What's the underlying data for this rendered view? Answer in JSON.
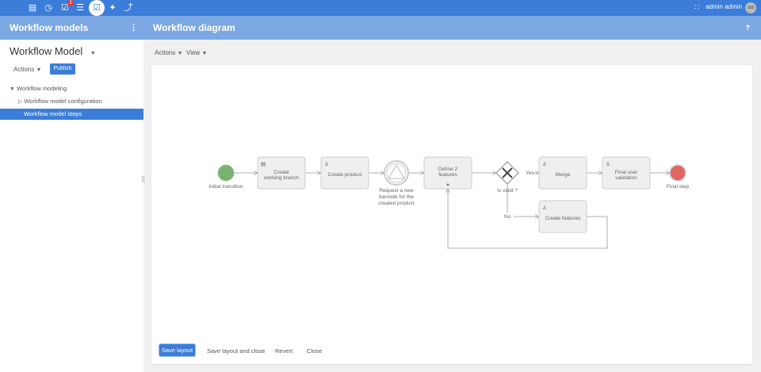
{
  "topbar": {
    "icons": [
      "database-icon",
      "clock-icon",
      "tasks-icon",
      "list-icon",
      "workflow-icon",
      "plug-icon",
      "wrench-icon"
    ],
    "badge": "2",
    "user": "admin admin",
    "avatar": "aa",
    "accent": "#3b7dd8"
  },
  "left_header": {
    "title": "Workflow models"
  },
  "right_header": {
    "title": "Workflow diagram",
    "help": "?"
  },
  "sidebar": {
    "title": "Workflow Model",
    "actions": "Actions",
    "publish": "Publish",
    "tree": [
      {
        "label": "Workflow modeling"
      },
      {
        "label": "Workflow model configuration"
      },
      {
        "label": "Workflow model steps"
      }
    ]
  },
  "toolbar": {
    "actions": "Actions",
    "view": "View"
  },
  "diagram": {
    "start": "Initial transition",
    "tasks": [
      "Create working branch",
      "Create product",
      "Define 2 features",
      "Merge",
      "Final user validation",
      "Create features"
    ],
    "event": [
      "Request a new",
      "barcode for the",
      "created product"
    ],
    "gateway": "Is valid ?",
    "yes": "Yes",
    "no": "No",
    "end": "Final step",
    "colors": {
      "start": "#7ab26f",
      "end": "#e06666"
    }
  },
  "footer": {
    "save_layout": "Save layout",
    "save_close": "Save layout and close",
    "revert": "Revert",
    "close": "Close"
  }
}
